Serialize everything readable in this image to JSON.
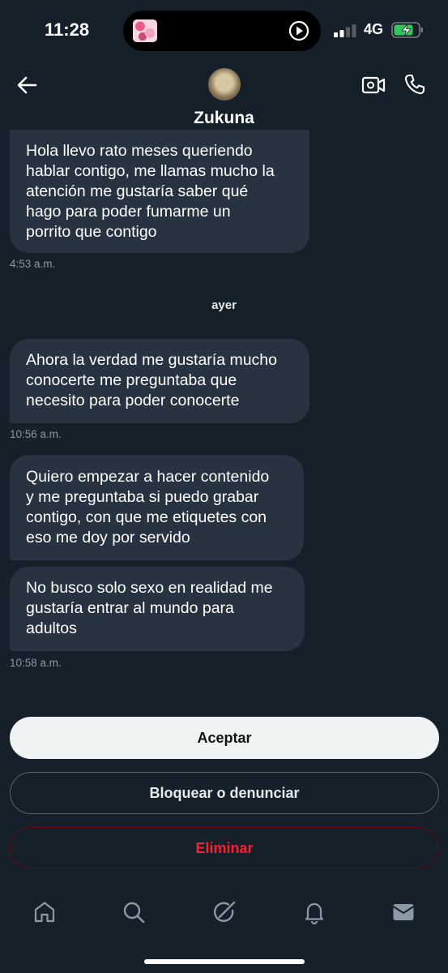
{
  "status_bar": {
    "time": "11:28",
    "network": "4G",
    "signal_bars_active": 2,
    "battery_charging": true
  },
  "header": {
    "contact_name": "Zukuna",
    "back_icon": "arrow-left-icon",
    "video_icon": "video-call-icon",
    "phone_icon": "phone-icon"
  },
  "messages": [
    {
      "text": "Hola llevo rato meses queriendo\nhablar contigo, me llamas mucho la\natención me gustaría saber qué\nhago para poder fumarme un\nporrito que contigo",
      "time": "4:53 a.m."
    },
    {
      "text": "Ahora la verdad me gustaría mucho\nconocerte me preguntaba que\nnecesito para poder conocerte",
      "time": "10:56 a.m."
    },
    {
      "text": "Quiero empezar a hacer contenido\ny me preguntaba si puedo grabar\ncontigo, con que me etiquetes con\neso me doy por servido",
      "time": ""
    },
    {
      "text": "No busco solo sexo en realidad me\ngustaría entrar al mundo para\nadultos",
      "time": "10:58 a.m."
    }
  ],
  "day_separator": "ayer",
  "actions": {
    "accept": "Aceptar",
    "block": "Bloquear o denunciar",
    "delete": "Eliminar"
  },
  "colors": {
    "background": "#15202b",
    "bubble": "#273340",
    "timestamp": "#8b98a5",
    "danger": "#f4212e",
    "accept_bg": "#eff3f4"
  },
  "nav": [
    "home-icon",
    "search-icon",
    "grok-icon",
    "notifications-icon",
    "messages-icon"
  ]
}
